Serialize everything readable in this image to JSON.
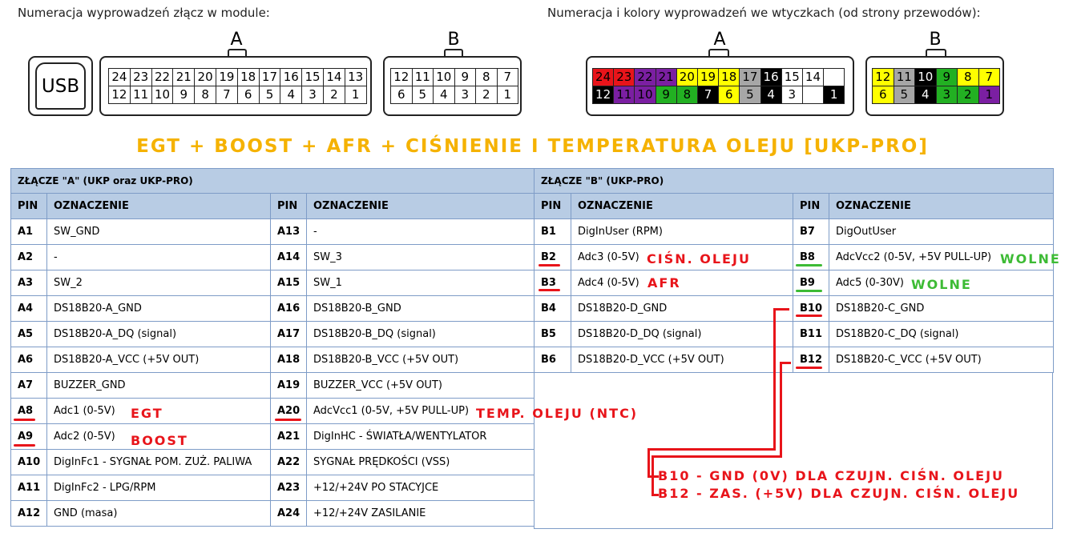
{
  "header": {
    "module_label": "Numeracja wyprowadzeń złącz w module:",
    "plug_label": "Numeracja i kolory wyprowadzeń we wtyczkach (od strony przewodów):"
  },
  "usb_label": "USB",
  "connector_letters": {
    "a": "A",
    "b": "B"
  },
  "module_a": {
    "top": [
      "24",
      "23",
      "22",
      "21",
      "20",
      "19",
      "18",
      "17",
      "16",
      "15",
      "14",
      "13"
    ],
    "bottom": [
      "12",
      "11",
      "10",
      "9",
      "8",
      "7",
      "6",
      "5",
      "4",
      "3",
      "2",
      "1"
    ]
  },
  "module_b": {
    "top": [
      "12",
      "11",
      "10",
      "9",
      "8",
      "7"
    ],
    "bottom": [
      "6",
      "5",
      "4",
      "3",
      "2",
      "1"
    ]
  },
  "plug_a": {
    "top": [
      {
        "n": "24",
        "bg": "#e8141a",
        "fg": "#000"
      },
      {
        "n": "23",
        "bg": "#e8141a",
        "fg": "#000"
      },
      {
        "n": "22",
        "bg": "#7b1fa2",
        "fg": "#000"
      },
      {
        "n": "21",
        "bg": "#7b1fa2",
        "fg": "#000"
      },
      {
        "n": "20",
        "bg": "#ffff00",
        "fg": "#000"
      },
      {
        "n": "19",
        "bg": "#ffff00",
        "fg": "#000"
      },
      {
        "n": "18",
        "bg": "#ffff00",
        "fg": "#000"
      },
      {
        "n": "17",
        "bg": "#a6a6a6",
        "fg": "#000"
      },
      {
        "n": "16",
        "bg": "#000000",
        "fg": "#fff"
      },
      {
        "n": "15",
        "bg": "#ffffff",
        "fg": "#000"
      },
      {
        "n": "14",
        "bg": "#ffffff",
        "fg": "#000"
      },
      {
        "n": "",
        "bg": "#ffffff",
        "fg": "#000"
      }
    ],
    "bottom": [
      {
        "n": "12",
        "bg": "#000000",
        "fg": "#fff"
      },
      {
        "n": "11",
        "bg": "#7b1fa2",
        "fg": "#000"
      },
      {
        "n": "10",
        "bg": "#7b1fa2",
        "fg": "#000"
      },
      {
        "n": "9",
        "bg": "#22b022",
        "fg": "#000"
      },
      {
        "n": "8",
        "bg": "#22b022",
        "fg": "#000"
      },
      {
        "n": "7",
        "bg": "#000000",
        "fg": "#fff"
      },
      {
        "n": "6",
        "bg": "#ffff00",
        "fg": "#000"
      },
      {
        "n": "5",
        "bg": "#a6a6a6",
        "fg": "#000"
      },
      {
        "n": "4",
        "bg": "#000000",
        "fg": "#fff"
      },
      {
        "n": "3",
        "bg": "#ffffff",
        "fg": "#000"
      },
      {
        "n": "",
        "bg": "#ffffff",
        "fg": "#000"
      },
      {
        "n": "1",
        "bg": "#000000",
        "fg": "#fff"
      }
    ]
  },
  "plug_b": {
    "top": [
      {
        "n": "12",
        "bg": "#ffff00",
        "fg": "#000"
      },
      {
        "n": "11",
        "bg": "#a6a6a6",
        "fg": "#000"
      },
      {
        "n": "10",
        "bg": "#000000",
        "fg": "#fff"
      },
      {
        "n": "9",
        "bg": "#22b022",
        "fg": "#000"
      },
      {
        "n": "8",
        "bg": "#ffff00",
        "fg": "#000"
      },
      {
        "n": "7",
        "bg": "#ffff00",
        "fg": "#000"
      }
    ],
    "bottom": [
      {
        "n": "6",
        "bg": "#ffff00",
        "fg": "#000"
      },
      {
        "n": "5",
        "bg": "#a6a6a6",
        "fg": "#000"
      },
      {
        "n": "4",
        "bg": "#000000",
        "fg": "#fff"
      },
      {
        "n": "3",
        "bg": "#22b022",
        "fg": "#000"
      },
      {
        "n": "2",
        "bg": "#22b022",
        "fg": "#000"
      },
      {
        "n": "1",
        "bg": "#7b1fa2",
        "fg": "#000"
      }
    ]
  },
  "title": "EGT + BOOST + AFR + CIŚNIENIE I TEMPERATURA OLEJU [UKP-PRO]",
  "table_a": {
    "section": "ZŁĄCZE \"A\" (UKP oraz UKP-PRO)",
    "col_pin": "PIN",
    "col_desc": "OZNACZENIE",
    "rows": [
      [
        "A1",
        "SW_GND",
        "A13",
        "-"
      ],
      [
        "A2",
        "-",
        "A14",
        "SW_3"
      ],
      [
        "A3",
        "SW_2",
        "A15",
        "SW_1"
      ],
      [
        "A4",
        "DS18B20-A_GND",
        "A16",
        "DS18B20-B_GND"
      ],
      [
        "A5",
        "DS18B20-A_DQ (signal)",
        "A17",
        "DS18B20-B_DQ (signal)"
      ],
      [
        "A6",
        "DS18B20-A_VCC (+5V OUT)",
        "A18",
        "DS18B20-B_VCC (+5V OUT)"
      ],
      [
        "A7",
        "BUZZER_GND",
        "A19",
        "BUZZER_VCC (+5V OUT)"
      ],
      [
        "A8",
        "Adc1 (0-5V)",
        "A20",
        "AdcVcc1 (0-5V, +5V PULL-UP)"
      ],
      [
        "A9",
        "Adc2 (0-5V)",
        "A21",
        "DigInHC - ŚWIATŁA/WENTYLATOR"
      ],
      [
        "A10",
        "DigInFc1 - SYGNAŁ POM. ZUŻ. PALIWA",
        "A22",
        "SYGNAŁ PRĘDKOŚCI (VSS)"
      ],
      [
        "A11",
        "DigInFc2 - LPG/RPM",
        "A23",
        "+12/+24V PO STACYJCE"
      ],
      [
        "A12",
        "GND (masa)",
        "A24",
        "+12/+24V ZASILANIE"
      ]
    ]
  },
  "table_b": {
    "section": "ZŁĄCZE \"B\" (UKP-PRO)",
    "col_pin": "PIN",
    "col_desc": "OZNACZENIE",
    "rows": [
      [
        "B1",
        "DigInUser (RPM)",
        "B7",
        "DigOutUser"
      ],
      [
        "B2",
        "Adc3 (0-5V)",
        "B8",
        "AdcVcc2 (0-5V, +5V PULL-UP)"
      ],
      [
        "B3",
        "Adc4 (0-5V)",
        "B9",
        "Adc5 (0-30V)"
      ],
      [
        "B4",
        "DS18B20-D_GND",
        "B10",
        "DS18B20-C_GND"
      ],
      [
        "B5",
        "DS18B20-D_DQ (signal)",
        "B11",
        "DS18B20-C_DQ (signal)"
      ],
      [
        "B6",
        "DS18B20-D_VCC (+5V OUT)",
        "B12",
        "DS18B20-C_VCC (+5V OUT)"
      ]
    ]
  },
  "annotations": {
    "egt": "EGT",
    "boost": "BOOST",
    "temp_oleju": "TEMP. OLEJU (NTC)",
    "cisn_oleju": "CIŚN. OLEJU",
    "afr": "AFR",
    "wolne_b8": "WOLNE",
    "wolne_b9": "WOLNE",
    "b10_note": "B10 - GND (0V) DLA CZUJN. CIŚN. OLEJU",
    "b12_note": "B12 - ZAS. (+5V) DLA CZUJN. CIŚN. OLEJU"
  },
  "colors": {
    "title": "#f5b200",
    "annotation_red": "#e8141a",
    "annotation_green": "#3dbb35",
    "table_header": "#b8cce4",
    "table_border": "#7e9cc7"
  }
}
